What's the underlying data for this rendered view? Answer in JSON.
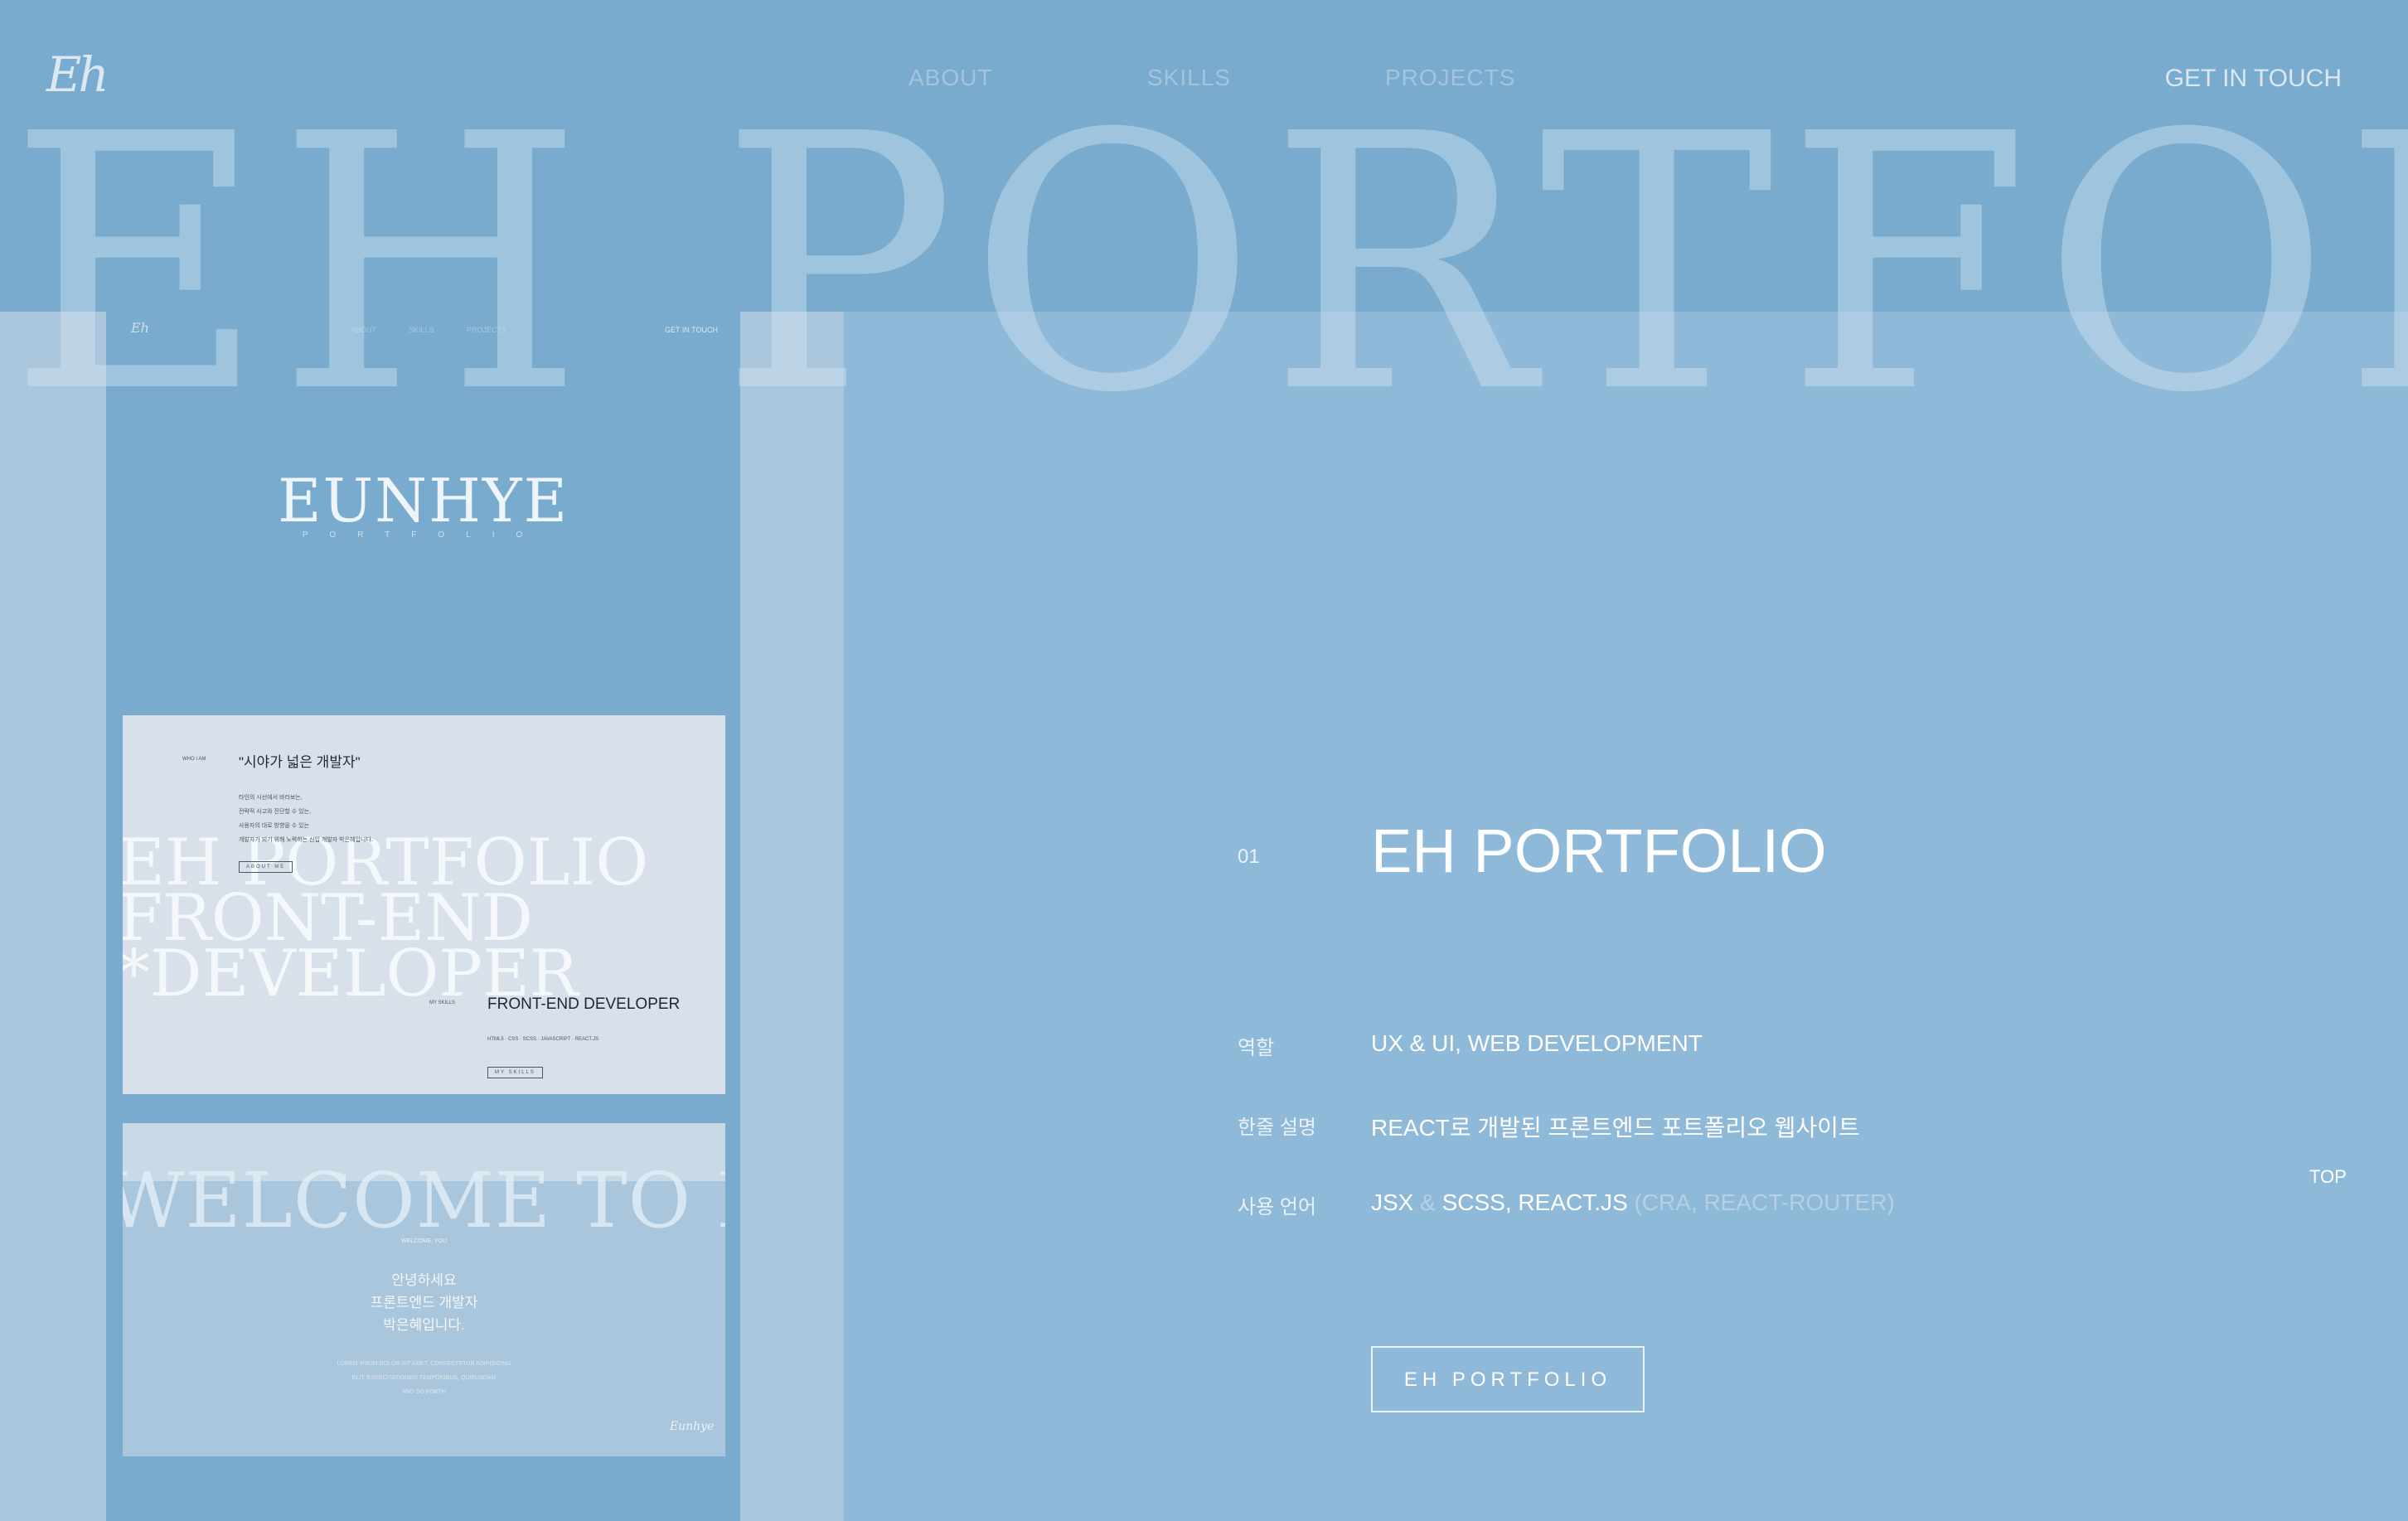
{
  "header": {
    "logo": "Eh",
    "nav": [
      "ABOUT",
      "SKILLS",
      "PROJECTS"
    ],
    "contact": "GET IN TOUCH"
  },
  "hero_bg_text": "EH PORTFOLIO",
  "preview": {
    "mini_logo": "Eh",
    "mini_nav": [
      "ABOUT",
      "SKILLS",
      "PROJECTS"
    ],
    "mini_contact": "GET IN TOUCH",
    "brand": "EUNHYE",
    "brand_sub": "PORTFOLIO",
    "card1": {
      "bg_lines": [
        "EH PORTFOLIO",
        "FRONT-END",
        "*DEVELOPER"
      ],
      "label": "WHO I AM",
      "quote": "\"시야가 넓은 개발자\"",
      "lines": [
        "타인의 시선에서 바라보는,",
        "전략적 사고와 진단할 수 있는,",
        "사용자의 대로 방향을 수 있는",
        "개발자가 되기 위해 노력하는 신입 개발자 박은혜입니다."
      ],
      "about_btn": "ABOUT ME",
      "skills_label": "MY SKILLS",
      "dev_title": "FRONT-END DEVELOPER",
      "stack": "HTML5 · CSS · SCSS · JAVASCRIPT · REACT.JS",
      "skills_btn": "MY SKILLS"
    },
    "card2": {
      "bg_text": "WELCOME TO EH",
      "label": "WELCOME, YOU",
      "greeting": [
        "안녕하세요",
        "프론트엔드 개발자",
        "박은혜입니다."
      ],
      "small": [
        "LOREM IPSUM DOLOR SIT AMET, CONSECTETUR ADIPISICING",
        "ELIT. EXERCITATIONEM TEMPORIBUS, QUIBUSDAM",
        "AND SO FORTH"
      ],
      "signature": "Eunhye"
    }
  },
  "project": {
    "number": "01",
    "title": "EH PORTFOLIO",
    "rows": [
      {
        "label": "역할",
        "value": "UX & UI, WEB DEVELOPMENT"
      },
      {
        "label": "한줄 설명",
        "value": "REACT로 개발된 프론트엔드 포트폴리오 웹사이트"
      },
      {
        "label": "사용 언어",
        "value_a": "JSX",
        "sep": "&",
        "value_b": "SCSS, REACT.JS",
        "value_c": "(CRA, REACT-ROUTER)"
      }
    ],
    "button": "EH PORTFOLIO"
  },
  "top_label": "TOP",
  "colors": {
    "background": "#78abcd",
    "panel": "#8fb9d8",
    "text": "#ffffff"
  }
}
